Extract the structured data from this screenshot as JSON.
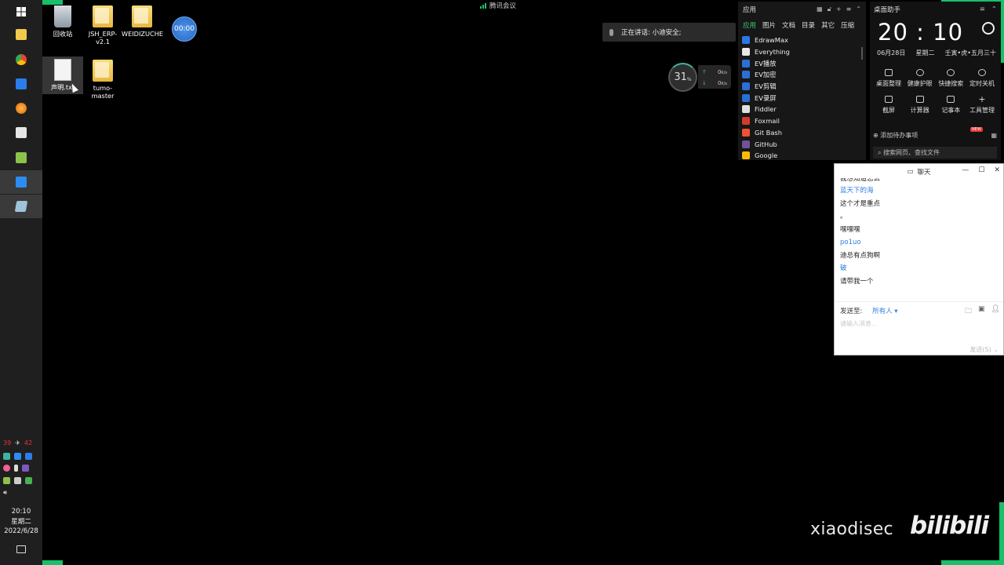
{
  "desktop": {
    "icons": [
      {
        "label": "回收站",
        "icon": "recycle-bin-icon"
      },
      {
        "label": "JSH_ERP-v2.1",
        "icon": "folder-icon"
      },
      {
        "label": "WEIDIZUCHE",
        "icon": "folder-icon"
      },
      {
        "label": "声明.txt",
        "icon": "text-file-icon"
      },
      {
        "label": "tumo-master",
        "icon": "folder-icon"
      }
    ],
    "timer": "00:00"
  },
  "meeting": {
    "title": "腾讯会议",
    "speaking": "正在讲话: 小迪安全;"
  },
  "netmonitor": {
    "cpu": "31",
    "cpu_unit": "%",
    "up": "0",
    "down": "0",
    "unit": "K/s"
  },
  "apps": {
    "title": "应用",
    "tabs": [
      "应用",
      "图片",
      "文档",
      "目录",
      "其它",
      "压缩"
    ],
    "items": [
      "EdrawMax",
      "Everything",
      "EV播放",
      "EV加密",
      "EV剪辑",
      "EV录屏",
      "Fiddler",
      "Foxmail",
      "Git Bash",
      "GitHub",
      "Google"
    ],
    "icon_colors": [
      "#2b78e4",
      "#e8e8e8",
      "#2b6fd6",
      "#2b6fd6",
      "#2b6fd6",
      "#2b6fd6",
      "#e0e0e0",
      "#d33b2c",
      "#f05133",
      "#6e5494",
      "#fbbc05"
    ]
  },
  "assistant": {
    "title": "桌面助手",
    "hour": "20",
    "minute": "10",
    "date": "06月28日",
    "weekday": "星期二",
    "lunar": "壬寅•虎•五月三十",
    "row1": [
      "桌面整理",
      "健康护眼",
      "快捷搜索",
      "定时关机"
    ],
    "row2": [
      "截屏",
      "计算器",
      "记事本",
      "工具管理"
    ],
    "todo": "添加待办事项",
    "search_placeholder": "搜索网页、查找文件",
    "new_badge": "NEW"
  },
  "chat": {
    "title": "聊天",
    "messages": [
      {
        "text": "我想知道怎么",
        "blue": false
      },
      {
        "text": "蓝天下的海",
        "blue": true
      },
      {
        "text": "这个才是重点",
        "blue": false
      },
      {
        "text": "。",
        "blue": false
      },
      {
        "text": "嘿嘿嘿",
        "blue": false
      },
      {
        "text": "po1uo",
        "blue": true
      },
      {
        "text": "迪总有点狗啊",
        "blue": false
      },
      {
        "text": "破",
        "blue": true
      },
      {
        "text": "请带我一个",
        "blue": false
      }
    ],
    "send_to_label": "发送至:",
    "send_to_value": "所有人",
    "input_placeholder": "请输入消息...",
    "send_button": "发送(S)"
  },
  "taskbar": {
    "tray_left": "39",
    "tray_right": "42",
    "time": "20:10",
    "weekday": "星期二",
    "date": "2022/6/28"
  },
  "watermark": {
    "channel": "xiaodisec",
    "site": "bilibili"
  },
  "colors": {
    "accent_green": "#18c06a",
    "link_blue": "#2f7ee0"
  }
}
